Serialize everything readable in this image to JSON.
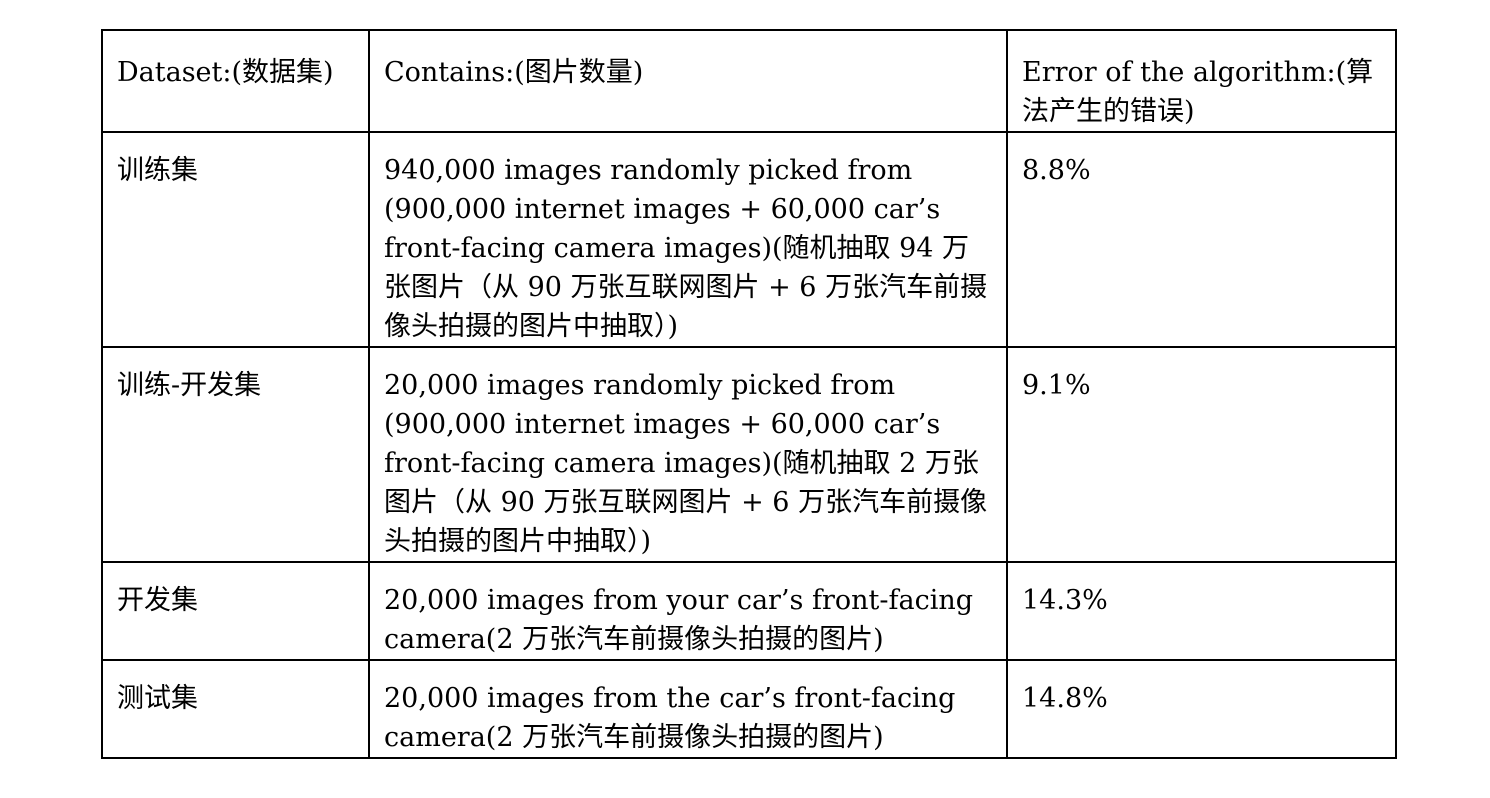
{
  "table": {
    "headers": [
      "Dataset:(数据集)",
      "Contains:(图片数量)",
      "Error of the algorithm:(算法产生的错误)"
    ],
    "rows": [
      {
        "dataset": "训练集",
        "contains": "940,000 images randomly picked from (900,000 internet images + 60,000 car’s front-facing camera images)(随机抽取 94 万张图片（从 90 万张互联网图片 + 6 万张汽车前摄像头拍摄的图片中抽取）)",
        "error": "8.8%"
      },
      {
        "dataset": "训练-开发集",
        "contains": "20,000 images randomly picked from (900,000 internet images + 60,000 car’s front-facing camera images)(随机抽取 2 万张图片（从 90 万张互联网图片 + 6 万张汽车前摄像头拍摄的图片中抽取）)",
        "error": "9.1%"
      },
      {
        "dataset": "开发集",
        "contains": "20,000 images from your car’s front-facing camera(2 万张汽车前摄像头拍摄的图片)",
        "error": "14.3%"
      },
      {
        "dataset": "测试集",
        "contains": "20,000 images from the car’s front-facing camera(2 万张汽车前摄像头拍摄的图片)",
        "error": "14.8%"
      }
    ]
  }
}
